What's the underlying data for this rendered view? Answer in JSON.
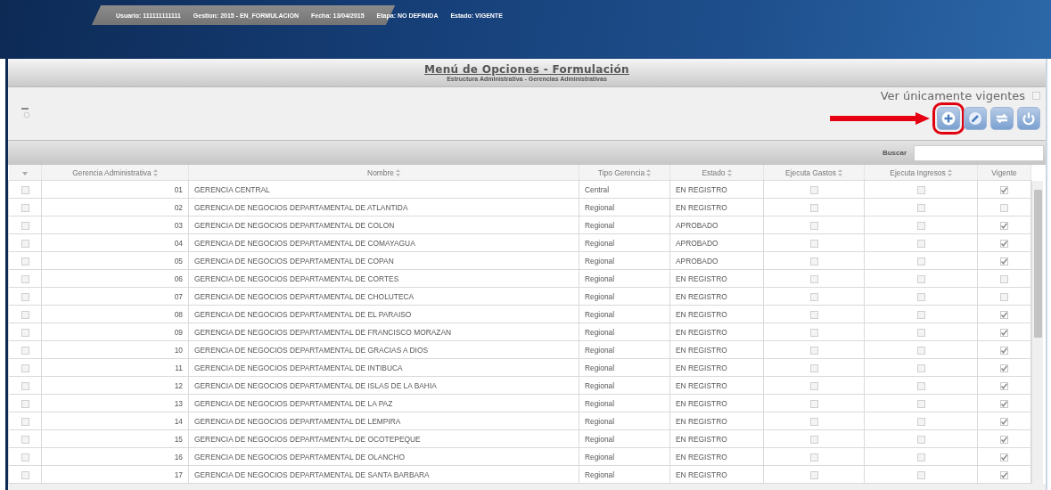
{
  "header": {
    "fields": [
      {
        "label": "Usuario:",
        "value": "111111111111"
      },
      {
        "label": "Gestion:",
        "value": "2015 - EN_FORMULACION"
      },
      {
        "label": "Fecha:",
        "value": "13/04/2015"
      },
      {
        "label": "Etapa:",
        "value": "NO DEFINIDA"
      },
      {
        "label": "Estado:",
        "value": "VIGENTE"
      }
    ]
  },
  "menu": {
    "title": "Menú de Opciones - Formulación",
    "subtitle": "Estructura Administrativa - Gerencias Administrativas"
  },
  "filter": {
    "label": "Ver únicamente vigentes",
    "checked": false
  },
  "toolbar": {
    "buttons": [
      {
        "kind": "add",
        "highlighted": true
      },
      {
        "kind": "edit",
        "highlighted": false
      },
      {
        "kind": "swap",
        "highlighted": false
      },
      {
        "kind": "exit",
        "highlighted": false
      }
    ]
  },
  "search": {
    "label": "Buscar"
  },
  "table": {
    "columns": [
      "Gerencia Administrativa",
      "Nombre",
      "Tipo Gerencia",
      "Estado",
      "Ejecuta Gastos",
      "Ejecuta Ingresos",
      "Vigente"
    ],
    "rows": [
      {
        "selected": false,
        "code": "01",
        "name": "GERENCIA CENTRAL",
        "type": "Central",
        "status": "EN REGISTRO",
        "gastos": false,
        "ingresos": false,
        "vigente": true
      },
      {
        "selected": false,
        "code": "02",
        "name": "GERENCIA DE NEGOCIOS DEPARTAMENTAL DE ATLANTIDA",
        "type": "Regional",
        "status": "EN REGISTRO",
        "gastos": false,
        "ingresos": false,
        "vigente": false
      },
      {
        "selected": false,
        "code": "03",
        "name": "GERENCIA DE NEGOCIOS DEPARTAMENTAL DE COLON",
        "type": "Regional",
        "status": "APROBADO",
        "gastos": false,
        "ingresos": false,
        "vigente": true
      },
      {
        "selected": false,
        "code": "04",
        "name": "GERENCIA DE NEGOCIOS DEPARTAMENTAL DE COMAYAGUA",
        "type": "Regional",
        "status": "APROBADO",
        "gastos": false,
        "ingresos": false,
        "vigente": true
      },
      {
        "selected": false,
        "code": "05",
        "name": "GERENCIA DE NEGOCIOS DEPARTAMENTAL DE COPAN",
        "type": "Regional",
        "status": "APROBADO",
        "gastos": false,
        "ingresos": false,
        "vigente": true
      },
      {
        "selected": false,
        "code": "06",
        "name": "GERENCIA DE NEGOCIOS DEPARTAMENTAL DE CORTES",
        "type": "Regional",
        "status": "EN REGISTRO",
        "gastos": false,
        "ingresos": false,
        "vigente": false
      },
      {
        "selected": false,
        "code": "07",
        "name": "GERENCIA DE NEGOCIOS DEPARTAMENTAL DE CHOLUTECA",
        "type": "Regional",
        "status": "EN REGISTRO",
        "gastos": false,
        "ingresos": false,
        "vigente": false
      },
      {
        "selected": false,
        "code": "08",
        "name": "GERENCIA DE NEGOCIOS DEPARTAMENTAL DE EL PARAISO",
        "type": "Regional",
        "status": "EN REGISTRO",
        "gastos": false,
        "ingresos": false,
        "vigente": true
      },
      {
        "selected": false,
        "code": "09",
        "name": "GERENCIA DE NEGOCIOS DEPARTAMENTAL DE FRANCISCO MORAZAN",
        "type": "Regional",
        "status": "EN REGISTRO",
        "gastos": false,
        "ingresos": false,
        "vigente": true
      },
      {
        "selected": false,
        "code": "10",
        "name": "GERENCIA DE NEGOCIOS DEPARTAMENTAL DE GRACIAS A DIOS",
        "type": "Regional",
        "status": "EN REGISTRO",
        "gastos": false,
        "ingresos": false,
        "vigente": true
      },
      {
        "selected": false,
        "code": "11",
        "name": "GERENCIA DE NEGOCIOS DEPARTAMENTAL DE INTIBUCA",
        "type": "Regional",
        "status": "EN REGISTRO",
        "gastos": false,
        "ingresos": false,
        "vigente": true
      },
      {
        "selected": false,
        "code": "12",
        "name": "GERENCIA DE NEGOCIOS DEPARTAMENTAL DE ISLAS DE LA BAHIA",
        "type": "Regional",
        "status": "EN REGISTRO",
        "gastos": false,
        "ingresos": false,
        "vigente": true
      },
      {
        "selected": false,
        "code": "13",
        "name": "GERENCIA DE NEGOCIOS DEPARTAMENTAL DE LA PAZ",
        "type": "Regional",
        "status": "EN REGISTRO",
        "gastos": false,
        "ingresos": false,
        "vigente": true
      },
      {
        "selected": false,
        "code": "14",
        "name": "GERENCIA DE NEGOCIOS DEPARTAMENTAL DE LEMPIRA",
        "type": "Regional",
        "status": "EN REGISTRO",
        "gastos": false,
        "ingresos": false,
        "vigente": true
      },
      {
        "selected": false,
        "code": "15",
        "name": "GERENCIA DE NEGOCIOS DEPARTAMENTAL DE OCOTEPEQUE",
        "type": "Regional",
        "status": "EN REGISTRO",
        "gastos": false,
        "ingresos": false,
        "vigente": true
      },
      {
        "selected": false,
        "code": "16",
        "name": "GERENCIA DE NEGOCIOS DEPARTAMENTAL DE OLANCHO",
        "type": "Regional",
        "status": "EN REGISTRO",
        "gastos": false,
        "ingresos": false,
        "vigente": true
      },
      {
        "selected": false,
        "code": "17",
        "name": "GERENCIA DE NEGOCIOS DEPARTAMENTAL DE SANTA BARBARA",
        "type": "Regional",
        "status": "EN REGISTRO",
        "gastos": false,
        "ingresos": false,
        "vigente": true
      }
    ]
  }
}
